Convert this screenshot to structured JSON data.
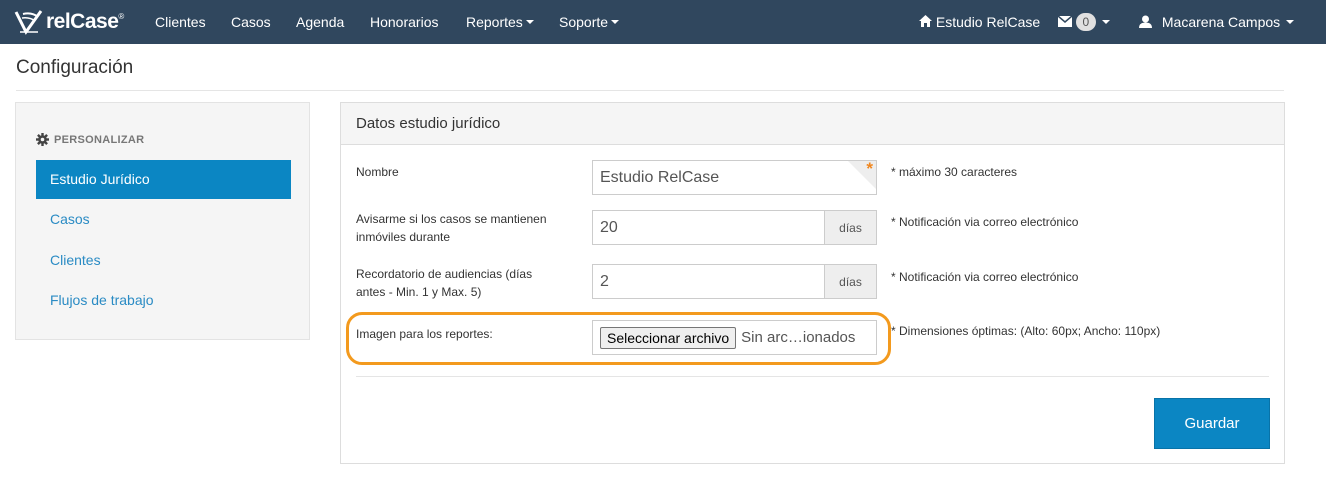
{
  "brand": {
    "name": "relCase",
    "reg": "®"
  },
  "nav": {
    "items": [
      "Clientes",
      "Casos",
      "Agenda",
      "Honorarios",
      "Reportes",
      "Soporte"
    ],
    "studio": "Estudio RelCase",
    "messages_count": "0",
    "user": "Macarena Campos"
  },
  "page": {
    "title": "Configuración"
  },
  "sidebar": {
    "heading": "PERSONALIZAR",
    "items": [
      "Estudio Jurídico",
      "Casos",
      "Clientes",
      "Flujos de trabajo"
    ]
  },
  "panel": {
    "heading": "Datos estudio jurídico",
    "nombre": {
      "label": "Nombre",
      "value": "Estudio RelCase",
      "required_mark": "*",
      "hint": "* máximo 30 caracteres"
    },
    "avisarme": {
      "label": "Avisarme si los casos se mantienen inmóviles durante",
      "value": "20",
      "addon": "días",
      "hint": "* Notificación via correo electrónico"
    },
    "recordatorio": {
      "label": "Recordatorio de audiencias (días antes - Min. 1 y Max. 5)",
      "value": "2",
      "addon": "días",
      "hint": "* Notificación via correo electrónico"
    },
    "imagen": {
      "label": "Imagen para los reportes:",
      "button": "Seleccionar archivo",
      "file_status": "Sin arc…ionados",
      "hint": "* Dimensiones óptimas: (Alto: 60px; Ancho: 110px)"
    },
    "save": "Guardar"
  },
  "colors": {
    "navbar": "#30475e",
    "primary": "#0b86c3",
    "highlight": "#f39a1e",
    "required": "#f0861e"
  }
}
